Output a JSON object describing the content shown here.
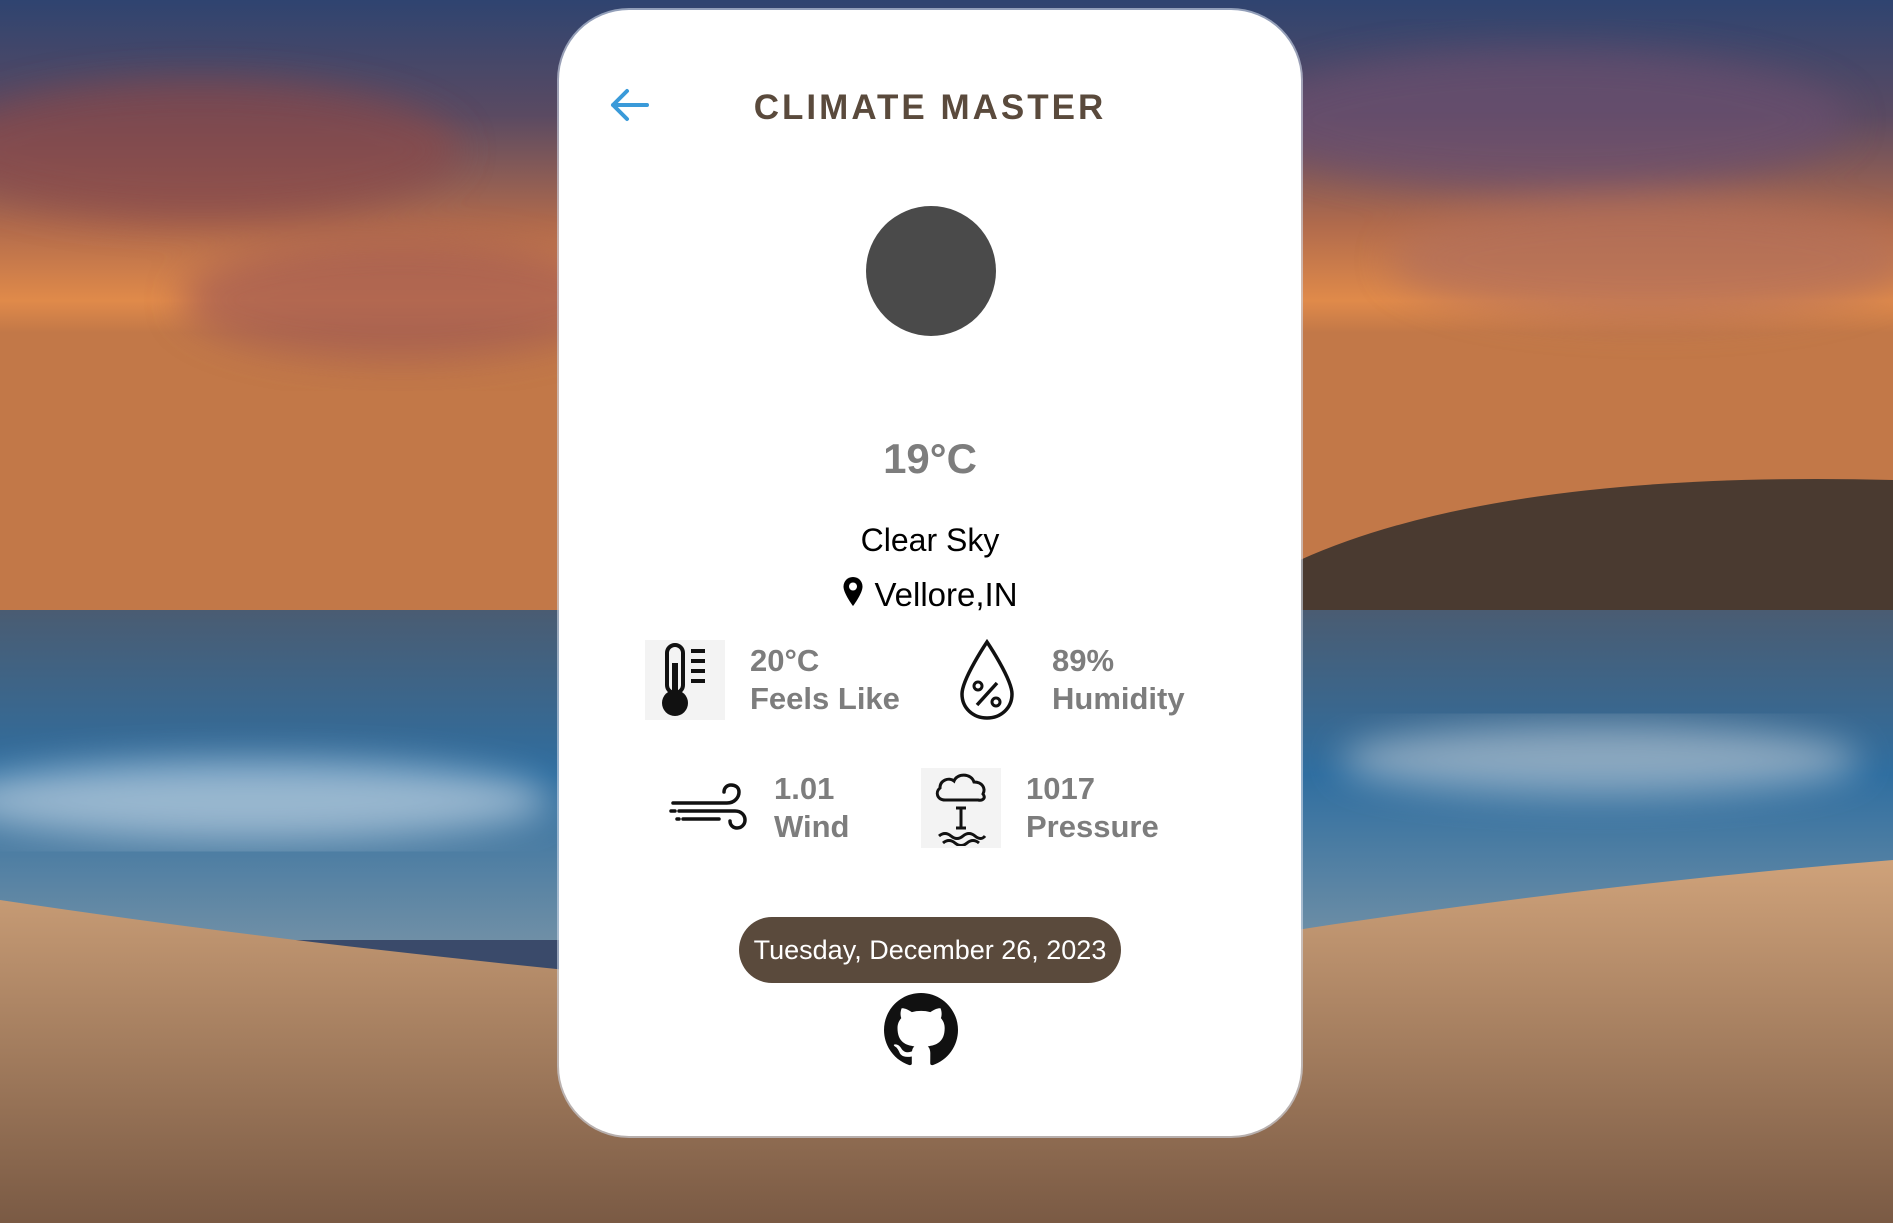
{
  "app": {
    "title": "CLIMATE MASTER"
  },
  "weather": {
    "temperature": "19°C",
    "description": "Clear Sky",
    "location": "Vellore,IN"
  },
  "stats": {
    "feels_like": {
      "value": "20°C",
      "label": "Feels Like",
      "icon": "thermometer-icon"
    },
    "humidity": {
      "value": "89%",
      "label": "Humidity",
      "icon": "humidity-drop-icon"
    },
    "wind": {
      "value": "1.01",
      "label": "Wind",
      "icon": "wind-icon"
    },
    "pressure": {
      "value": "1017",
      "label": "Pressure",
      "icon": "pressure-cloud-icon"
    }
  },
  "footer": {
    "date": "Tuesday, December 26, 2023",
    "github_icon": "github-icon"
  },
  "colors": {
    "accent_brown": "#5a4a3c",
    "back_arrow": "#3a9ad9",
    "stat_text": "#7d7d7d",
    "condition_icon": "#4a4a4a"
  }
}
